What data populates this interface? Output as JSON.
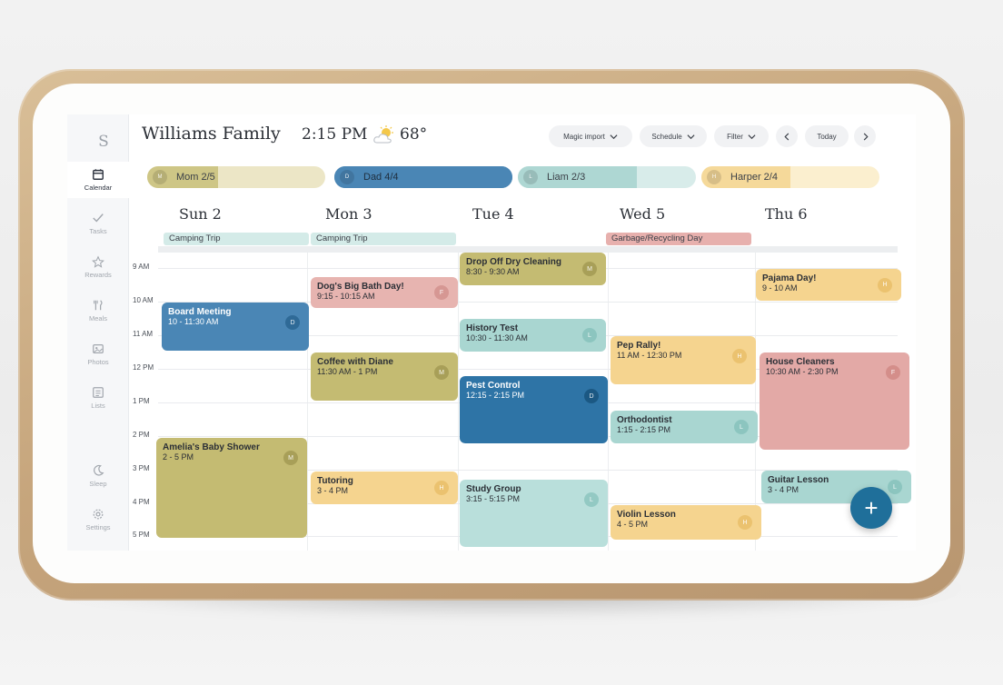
{
  "header": {
    "sidebar_avatar": "S",
    "title": "Williams Family",
    "time": "2:15 PM",
    "temperature": "68°",
    "weather_icon": "partly-sunny-icon",
    "buttons": {
      "magic_import": "Magic import",
      "schedule": "Schedule",
      "filter": "Filter",
      "today": "Today"
    }
  },
  "sidebar": {
    "items": [
      {
        "label": "Calendar",
        "icon": "calendar-icon",
        "active": true
      },
      {
        "label": "Tasks",
        "icon": "check-icon"
      },
      {
        "label": "Rewards",
        "icon": "star-icon"
      },
      {
        "label": "Meals",
        "icon": "utensils-icon"
      },
      {
        "label": "Photos",
        "icon": "photo-icon"
      },
      {
        "label": "Lists",
        "icon": "list-icon"
      },
      {
        "label": "Sleep",
        "icon": "moon-icon"
      },
      {
        "label": "Settings",
        "icon": "gear-icon"
      }
    ]
  },
  "people": [
    {
      "initial": "M",
      "label": "Mom 2/5",
      "progress": 0.4,
      "color": "#c9bf7a",
      "bg": "#ece6c6"
    },
    {
      "initial": "D",
      "label": "Dad 4/4",
      "progress": 1.0,
      "color": "#4a86b5",
      "bg": "#4a86b5"
    },
    {
      "initial": "L",
      "label": "Liam 2/3",
      "progress": 0.67,
      "color": "#a7d3cf",
      "bg": "#d8ecea"
    },
    {
      "initial": "H",
      "label": "Harper 2/4",
      "progress": 0.5,
      "color": "#f3d591",
      "bg": "#fbefcf"
    }
  ],
  "days": [
    {
      "label": "Sun 2"
    },
    {
      "label": "Mon 3"
    },
    {
      "label": "Tue 4"
    },
    {
      "label": "Wed 5"
    },
    {
      "label": "Thu 6"
    }
  ],
  "all_day_events": [
    {
      "title": "Camping Trip",
      "color": "#d4ebe8"
    },
    {
      "title": "Camping Trip",
      "color": "#d4ebe8"
    },
    {
      "title": "Garbage/Recycling Day",
      "color": "#e7b0ad"
    }
  ],
  "hours": [
    "9 AM",
    "10 AM",
    "11 AM",
    "12 PM",
    "1 PM",
    "2 PM",
    "3 PM",
    "4 PM",
    "5 PM"
  ],
  "events": [
    {
      "title": "Board Meeting",
      "time": "10 - 11:30 AM",
      "badge": "D",
      "color": "#4a86b5",
      "badge_color": "#2f6a97"
    },
    {
      "title": "Amelia's Baby Shower",
      "time": "2 - 5 PM",
      "badge": "M",
      "color": "#c4bb72",
      "badge_color": "#a89f58"
    },
    {
      "title": "Dog's Big Bath Day!",
      "time": "9:15 - 10:15 AM",
      "badge": "F",
      "color": "#e7b4b0",
      "badge_color": "#d69793"
    },
    {
      "title": "Coffee with Diane",
      "time": "11:30 AM - 1 PM",
      "badge": "M",
      "color": "#c4bb72",
      "badge_color": "#a89f58"
    },
    {
      "title": "Tutoring",
      "time": "3 - 4 PM",
      "badge": "H",
      "color": "#f5d48f",
      "badge_color": "#ebc26f"
    },
    {
      "title": "Drop Off Dry Cleaning",
      "time": "8:30 - 9:30 AM",
      "badge": "M",
      "color": "#c4bb72",
      "badge_color": "#a89f58"
    },
    {
      "title": "History Test",
      "time": "10:30 - 11:30 AM",
      "badge": "L",
      "color": "#a9d6d1",
      "badge_color": "#8cc5bf"
    },
    {
      "title": "Pest Control",
      "time": "12:15 - 2:15 PM",
      "badge": "D",
      "color": "#2e74a6",
      "badge_color": "#1b5883"
    },
    {
      "title": "Study Group",
      "time": "3:15 - 5:15 PM",
      "badge": "L",
      "color": "#b9dfdb",
      "badge_color": "#93c9c3"
    },
    {
      "title": "Pep Rally!",
      "time": "11 AM - 12:30 PM",
      "badge": "H",
      "color": "#f5d48f",
      "badge_color": "#ebc26f"
    },
    {
      "title": "Orthodontist",
      "time": "1:15 - 2:15 PM",
      "badge": "L",
      "color": "#a9d6d1",
      "badge_color": "#8cc5bf"
    },
    {
      "title": "Violin Lesson",
      "time": "4 - 5 PM",
      "badge": "H",
      "color": "#f5d48f",
      "badge_color": "#ebc26f"
    },
    {
      "title": "Pajama Day!",
      "time": "9 - 10 AM",
      "badge": "H",
      "color": "#f5d48f",
      "badge_color": "#ebc26f"
    },
    {
      "title": "House Cleaners",
      "time": "10:30 AM - 2:30 PM",
      "badge": "F",
      "color": "#e3a9a6",
      "badge_color": "#d48e8a"
    },
    {
      "title": "Guitar Lesson",
      "time": "3 - 4 PM",
      "badge": "L",
      "color": "#a9d6d1",
      "badge_color": "#8cc5bf"
    }
  ],
  "fab": {
    "label": "+"
  }
}
